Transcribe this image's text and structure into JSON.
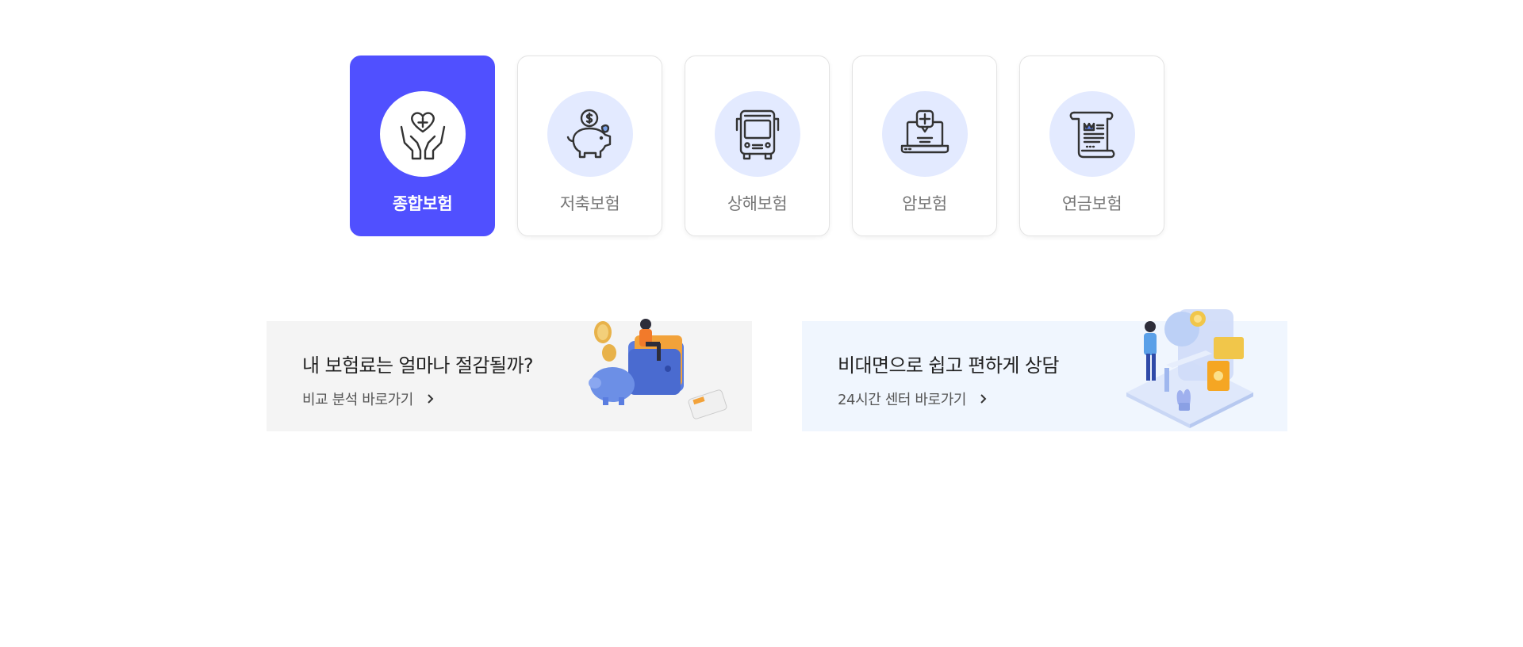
{
  "categories": [
    {
      "label": "종합보험",
      "icon": "hands-heart-icon",
      "active": true
    },
    {
      "label": "저축보험",
      "icon": "piggy-bank-icon",
      "active": false
    },
    {
      "label": "상해보험",
      "icon": "bus-icon",
      "active": false
    },
    {
      "label": "암보험",
      "icon": "laptop-medical-icon",
      "active": false
    },
    {
      "label": "연금보험",
      "icon": "scroll-document-icon",
      "active": false
    }
  ],
  "banners": [
    {
      "title": "내 보험료는 얼마나 절감될까?",
      "link": "비교 분석 바로가기",
      "background": "#f4f4f4",
      "illustration": "piggy-wallet-illustration"
    },
    {
      "title": "비대면으로 쉽고 편하게 상담",
      "link": "24시간 센터 바로가기",
      "background": "#f0f6fe",
      "illustration": "consultant-illustration"
    }
  ],
  "colors": {
    "accent": "#5050ff",
    "icon_bg": "#e3eaff"
  }
}
